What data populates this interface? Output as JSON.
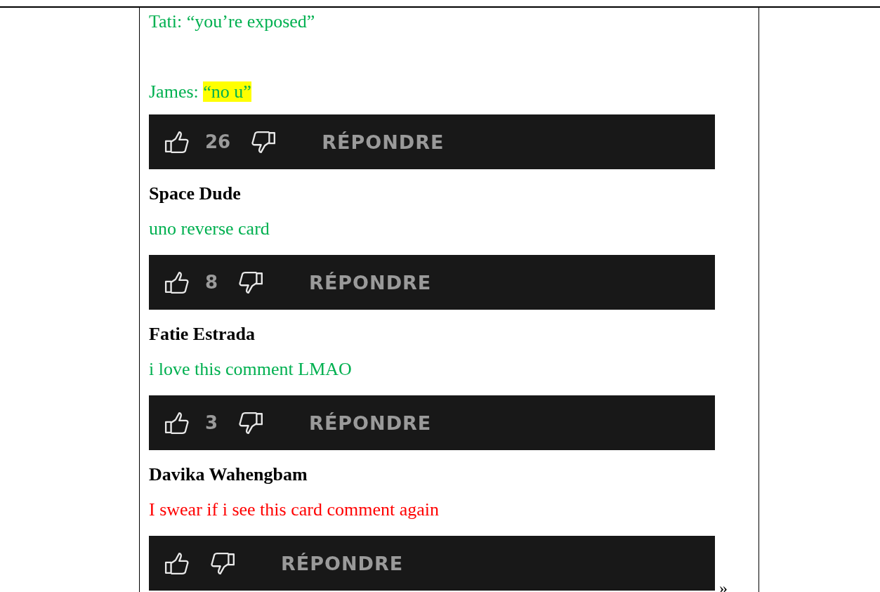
{
  "entries": [
    {
      "kind": "text",
      "text": "Tati: “you’re exposed”",
      "color": "#00b050"
    },
    {
      "kind": "spacer"
    },
    {
      "kind": "text",
      "text": "James: ",
      "highlight": "“no u”",
      "color": "#00b050"
    },
    {
      "kind": "bar",
      "likes": "26",
      "reply": "RÉPONDRE"
    },
    {
      "kind": "author",
      "text": "Space Dude"
    },
    {
      "kind": "text",
      "text": "uno reverse card",
      "color": "#00b050"
    },
    {
      "kind": "bar",
      "likes": "8",
      "reply": "RÉPONDRE"
    },
    {
      "kind": "author",
      "text": "Fatie Estrada"
    },
    {
      "kind": "text",
      "text": "i love this comment LMAO",
      "color": "#00b050"
    },
    {
      "kind": "bar",
      "likes": "3",
      "reply": "RÉPONDRE"
    },
    {
      "kind": "author",
      "text": "Davika Wahengbam"
    },
    {
      "kind": "text",
      "text": "I swear if i see this card comment again",
      "color": "#ff0000"
    },
    {
      "kind": "bar",
      "reply": "RÉPONDRE",
      "after": "»"
    }
  ]
}
